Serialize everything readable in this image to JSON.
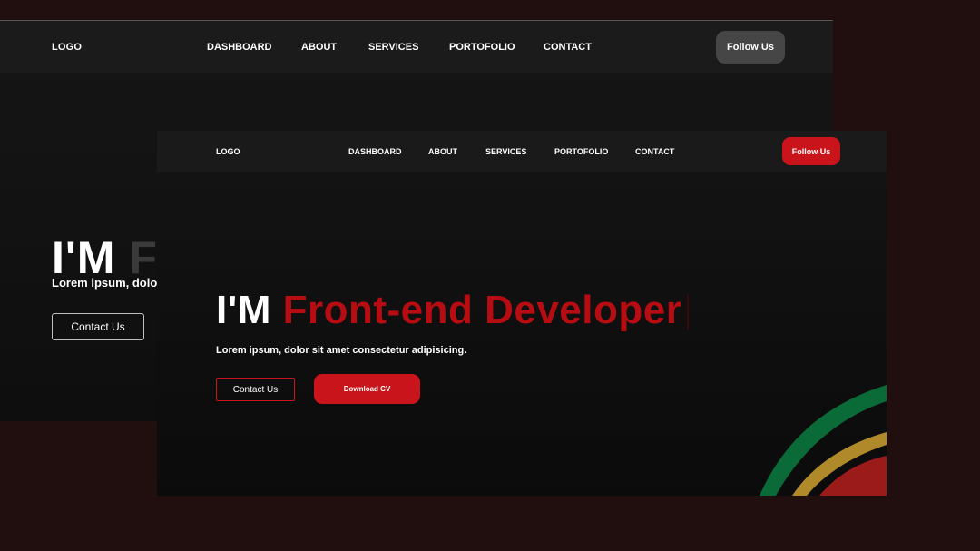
{
  "back_screen": {
    "logo": "LOGO",
    "nav": [
      "DASHBOARD",
      "ABOUT",
      "SERVICES",
      "PORTOFOLIO",
      "CONTACT"
    ],
    "follow_label": "Follow Us",
    "headline_prefix": "I'M",
    "headline_role": "F",
    "tagline": "Lorem ipsum, dolo",
    "contact_label": "Contact Us"
  },
  "front_screen": {
    "logo": "LOGO",
    "nav": [
      "DASHBOARD",
      "ABOUT",
      "SERVICES",
      "PORTOFOLIO",
      "CONTACT"
    ],
    "follow_label": "Follow Us",
    "headline_prefix": "I'M",
    "headline_role": "Front-end Developer",
    "tagline": "Lorem ipsum, dolor sit amet consectetur adipisicing.",
    "contact_label": "Contact Us",
    "download_label": "Download CV"
  },
  "colors": {
    "background": "#210f0f",
    "accent_red": "#c8141a",
    "role_red": "#b70d12",
    "follow_grey": "#464646",
    "decor_green": "#0b6b38",
    "decor_gold": "#b08a2a",
    "decor_red": "#9b1a1a"
  }
}
